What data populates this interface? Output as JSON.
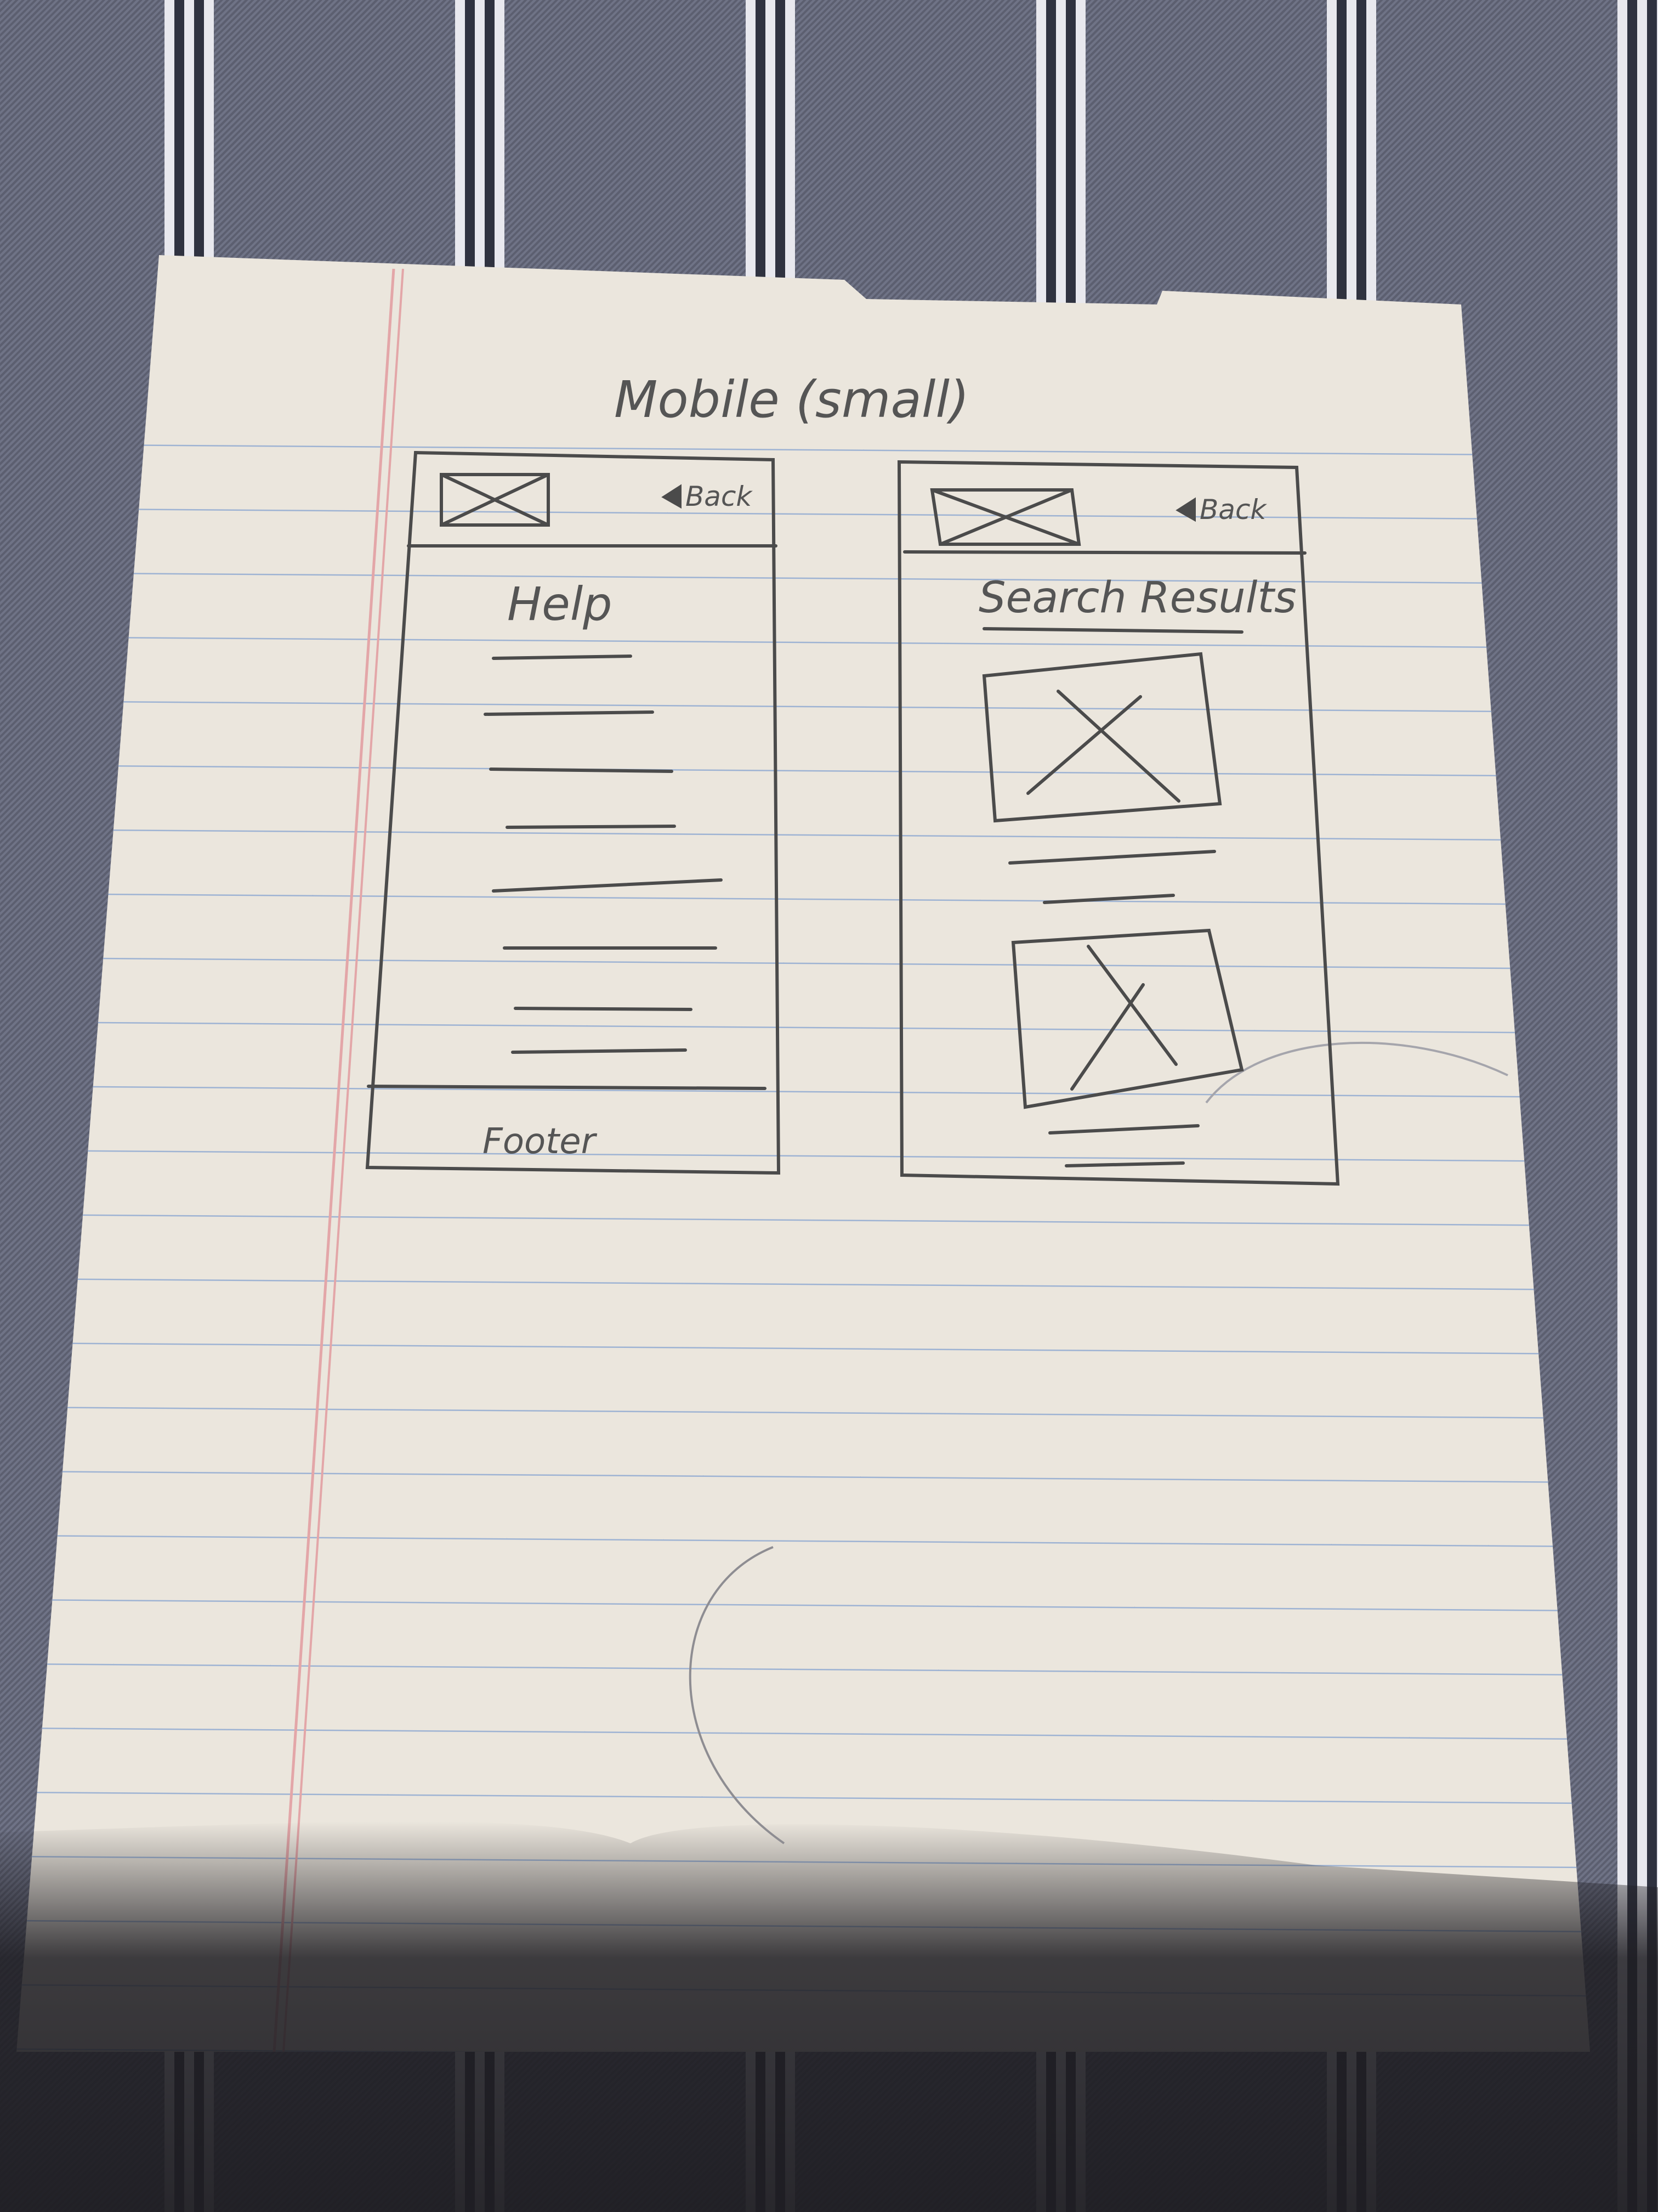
{
  "sheet": {
    "heading": "Mobile (small)",
    "colors": {
      "paper": "#ebe6dd",
      "rule": "#9eb3d3",
      "margin": "#e3a6a8",
      "pencil": "#4b4b4b",
      "shadow": "#262528"
    }
  },
  "wireframes": [
    {
      "id": "help-screen",
      "back_label": "Back",
      "title": "Help",
      "footer": "Footer"
    },
    {
      "id": "search-results-screen",
      "back_label": "Back",
      "title": "Search Results"
    }
  ]
}
